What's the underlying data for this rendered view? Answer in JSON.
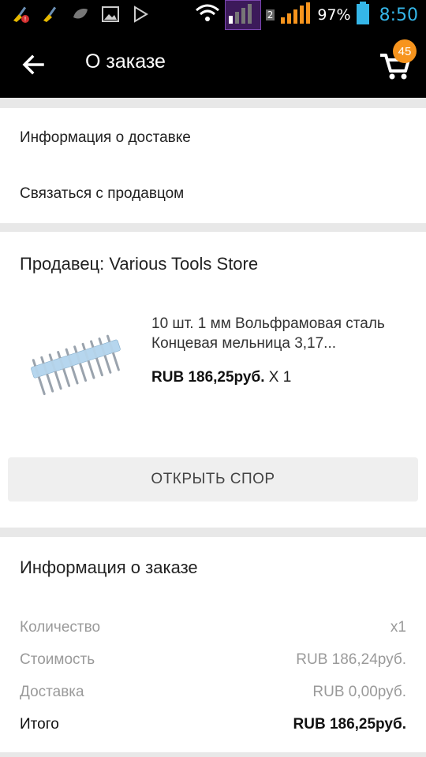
{
  "status_bar": {
    "battery_percent": "97%",
    "time": "8:50",
    "sim_number": "2",
    "icons": [
      "broom-alert-icon",
      "broom-icon",
      "leaf-icon",
      "image-icon",
      "play-store-icon",
      "wifi-icon",
      "signal-icon",
      "signal-icon",
      "battery-icon"
    ],
    "time_color": "#35b6e8"
  },
  "app_bar": {
    "title": "О заказе",
    "cart_count": "45",
    "badge_color": "#f7941d"
  },
  "links": {
    "delivery_info": "Информация о доставке",
    "contact_seller": "Связаться с продавцом"
  },
  "seller": {
    "title": "Продавец: Various Tools Store"
  },
  "product": {
    "name": "10 шт. 1 мм Вольфрамовая сталь Концевая мельница 3,17...",
    "price": "RUB 186,25руб.",
    "quantity": "X 1"
  },
  "dispute_button": "ОТКРЫТЬ СПОР",
  "order_info": {
    "title": "Информация о заказе",
    "rows": [
      {
        "label": "Количество",
        "value": "x1"
      },
      {
        "label": "Стоимость",
        "value": "RUB 186,24руб."
      },
      {
        "label": "Доставка",
        "value": "RUB 0,00руб."
      },
      {
        "label": "Итого",
        "value": "RUB 186,25руб."
      }
    ]
  }
}
